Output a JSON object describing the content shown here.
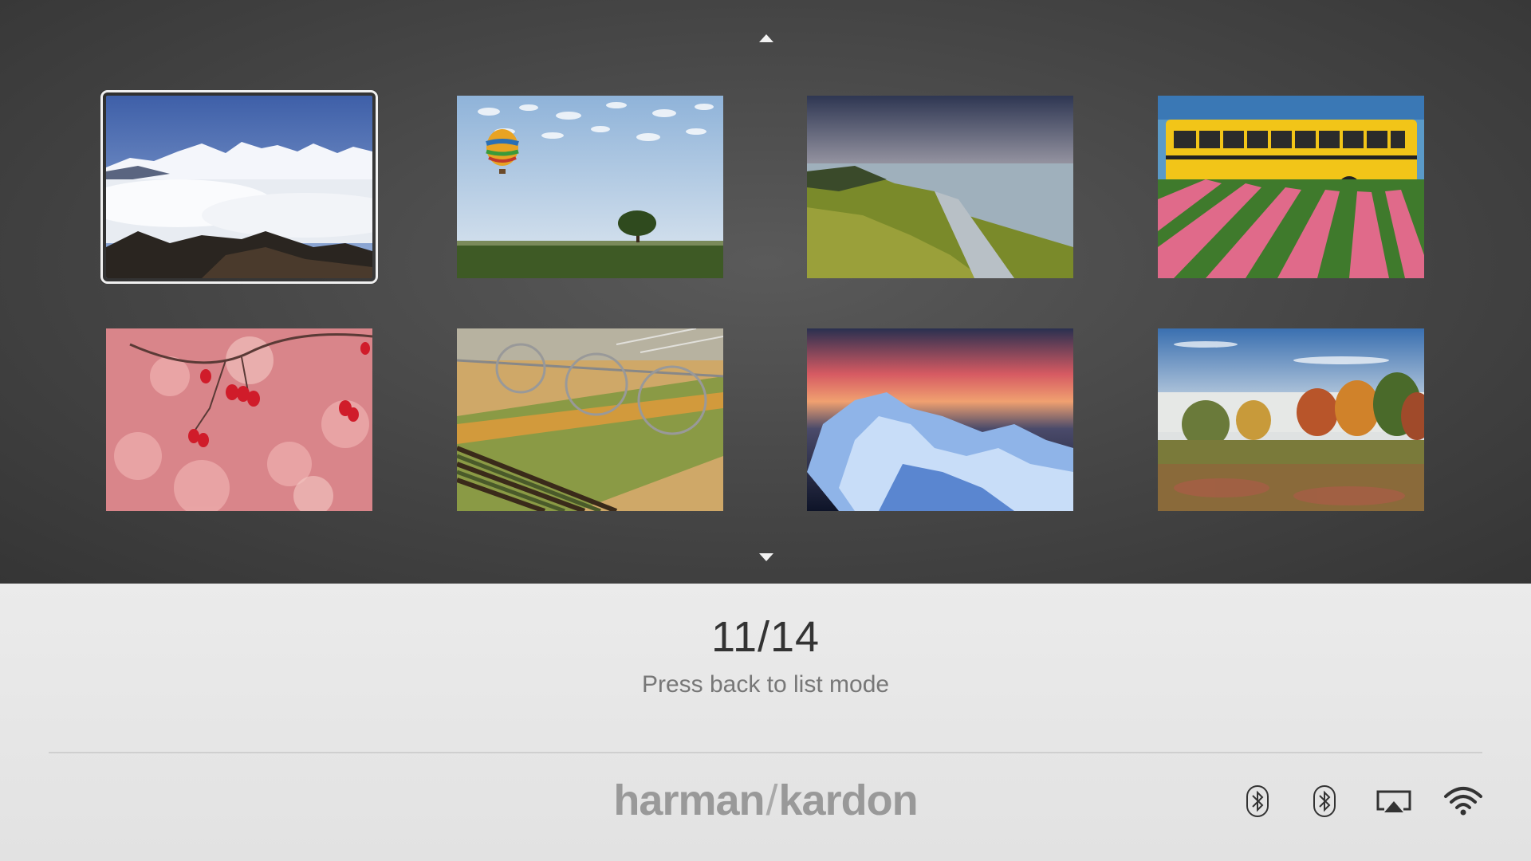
{
  "navigation": {
    "up_icon": "triangle-up-icon",
    "down_icon": "triangle-down-icon"
  },
  "thumbnails": [
    {
      "subject": "snowy mountains above clouds",
      "selected": true
    },
    {
      "subject": "hot air balloon over field with tree",
      "selected": false
    },
    {
      "subject": "coastal path at sunset",
      "selected": false
    },
    {
      "subject": "yellow school bus in tulip field",
      "selected": false
    },
    {
      "subject": "red berries on branch",
      "selected": false
    },
    {
      "subject": "irrigation sprinkler over crop field",
      "selected": false
    },
    {
      "subject": "ice on lake at sunset",
      "selected": false
    },
    {
      "subject": "autumn trees with fog",
      "selected": false
    }
  ],
  "status": {
    "counter": "11/14",
    "hint": "Press back to list mode"
  },
  "brand": {
    "left": "harman",
    "separator": "/",
    "right": "kardon"
  },
  "status_icons": [
    "bluetooth-icon",
    "bluetooth-icon",
    "airplay-icon",
    "wifi-icon"
  ],
  "colors": {
    "gallery_bg": "#454545",
    "bottom_bg": "#e8e8e8",
    "selection": "#f0f0f0",
    "logo": "#999999"
  }
}
